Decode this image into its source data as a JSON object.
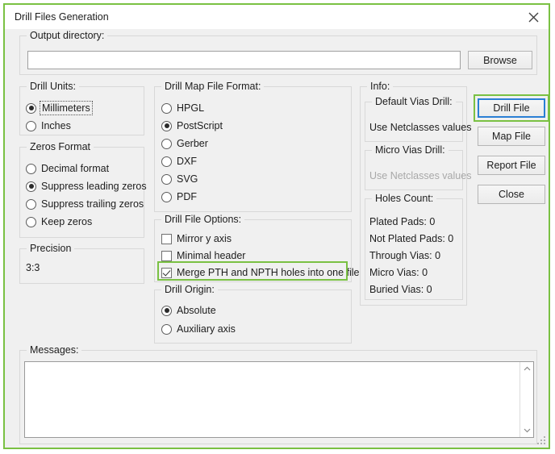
{
  "window": {
    "title": "Drill Files Generation",
    "close_icon": "close-icon"
  },
  "output_directory": {
    "legend": "Output directory:",
    "value": "",
    "placeholder": "",
    "browse_label": "Browse"
  },
  "drill_units": {
    "legend": "Drill Units:",
    "options": [
      {
        "label": "Millimeters",
        "selected": true,
        "focused": true
      },
      {
        "label": "Inches",
        "selected": false,
        "focused": false
      }
    ]
  },
  "zeros_format": {
    "legend": "Zeros Format",
    "options": [
      {
        "label": "Decimal format",
        "selected": false
      },
      {
        "label": "Suppress leading zeros",
        "selected": true
      },
      {
        "label": "Suppress trailing zeros",
        "selected": false
      },
      {
        "label": "Keep zeros",
        "selected": false
      }
    ]
  },
  "precision": {
    "legend": "Precision",
    "value": "3:3"
  },
  "drill_map_file_format": {
    "legend": "Drill Map File Format:",
    "options": [
      {
        "label": "HPGL",
        "selected": false
      },
      {
        "label": "PostScript",
        "selected": true
      },
      {
        "label": "Gerber",
        "selected": false
      },
      {
        "label": "DXF",
        "selected": false
      },
      {
        "label": "SVG",
        "selected": false
      },
      {
        "label": "PDF",
        "selected": false
      }
    ]
  },
  "drill_file_options": {
    "legend": "Drill File Options:",
    "options": [
      {
        "label": "Mirror y axis",
        "checked": false,
        "highlighted": false
      },
      {
        "label": "Minimal header",
        "checked": false,
        "highlighted": false
      },
      {
        "label": "Merge PTH and NPTH holes into one file",
        "checked": true,
        "highlighted": true
      }
    ]
  },
  "drill_origin": {
    "legend": "Drill Origin:",
    "options": [
      {
        "label": "Absolute",
        "selected": true
      },
      {
        "label": "Auxiliary axis",
        "selected": false
      }
    ]
  },
  "info": {
    "legend": "Info:",
    "default_vias_drill": {
      "legend": "Default Vias Drill:",
      "value": "Use Netclasses values",
      "disabled": false
    },
    "micro_vias_drill": {
      "legend": "Micro Vias Drill:",
      "value": "Use Netclasses values",
      "disabled": true
    },
    "holes_count": {
      "legend": "Holes Count:",
      "rows": [
        "Plated Pads: 0",
        "Not Plated Pads: 0",
        "Through Vias: 0",
        "Micro Vias: 0",
        "Buried Vias: 0"
      ]
    }
  },
  "action_buttons": [
    {
      "label": "Drill File",
      "focused": true,
      "highlighted": true
    },
    {
      "label": "Map File",
      "focused": false,
      "highlighted": false
    },
    {
      "label": "Report File",
      "focused": false,
      "highlighted": false
    },
    {
      "label": "Close",
      "focused": false,
      "highlighted": false
    }
  ],
  "messages": {
    "legend": "Messages:",
    "value": "",
    "scroll_up_icon": "chevron-up-icon",
    "scroll_down_icon": "chevron-down-icon"
  },
  "colors": {
    "highlight_green": "#7ac143",
    "focus_blue": "#2a7fd4",
    "dialog_background": "#f0f0f0",
    "group_border": "#d8d8d8"
  }
}
